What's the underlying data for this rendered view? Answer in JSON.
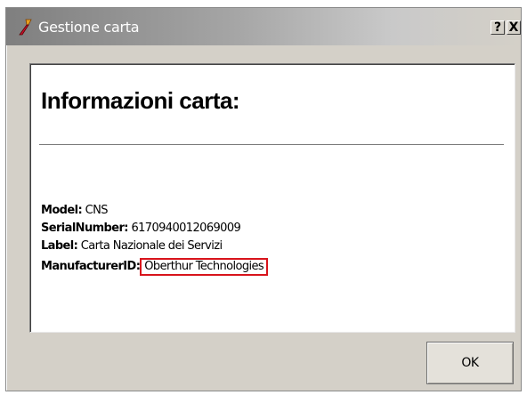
{
  "window": {
    "title": "Gestione carta",
    "help_glyph": "?",
    "close_glyph": "X",
    "icon": "card-tool-icon"
  },
  "panel": {
    "heading": "Informazioni carta:",
    "fields": {
      "model": {
        "key": "Model:",
        "value": "CNS"
      },
      "serial": {
        "key": "SerialNumber:",
        "value": "6170940012069009"
      },
      "label": {
        "key": "Label:",
        "value": "Carta Nazionale dei Servizi"
      },
      "manufacturer": {
        "key": "ManufacturerID:",
        "value": "Oberthur Technologies"
      }
    }
  },
  "buttons": {
    "ok": "OK"
  },
  "colors": {
    "highlight": "#d8141c",
    "dialog_bg": "#d4d0c8"
  }
}
